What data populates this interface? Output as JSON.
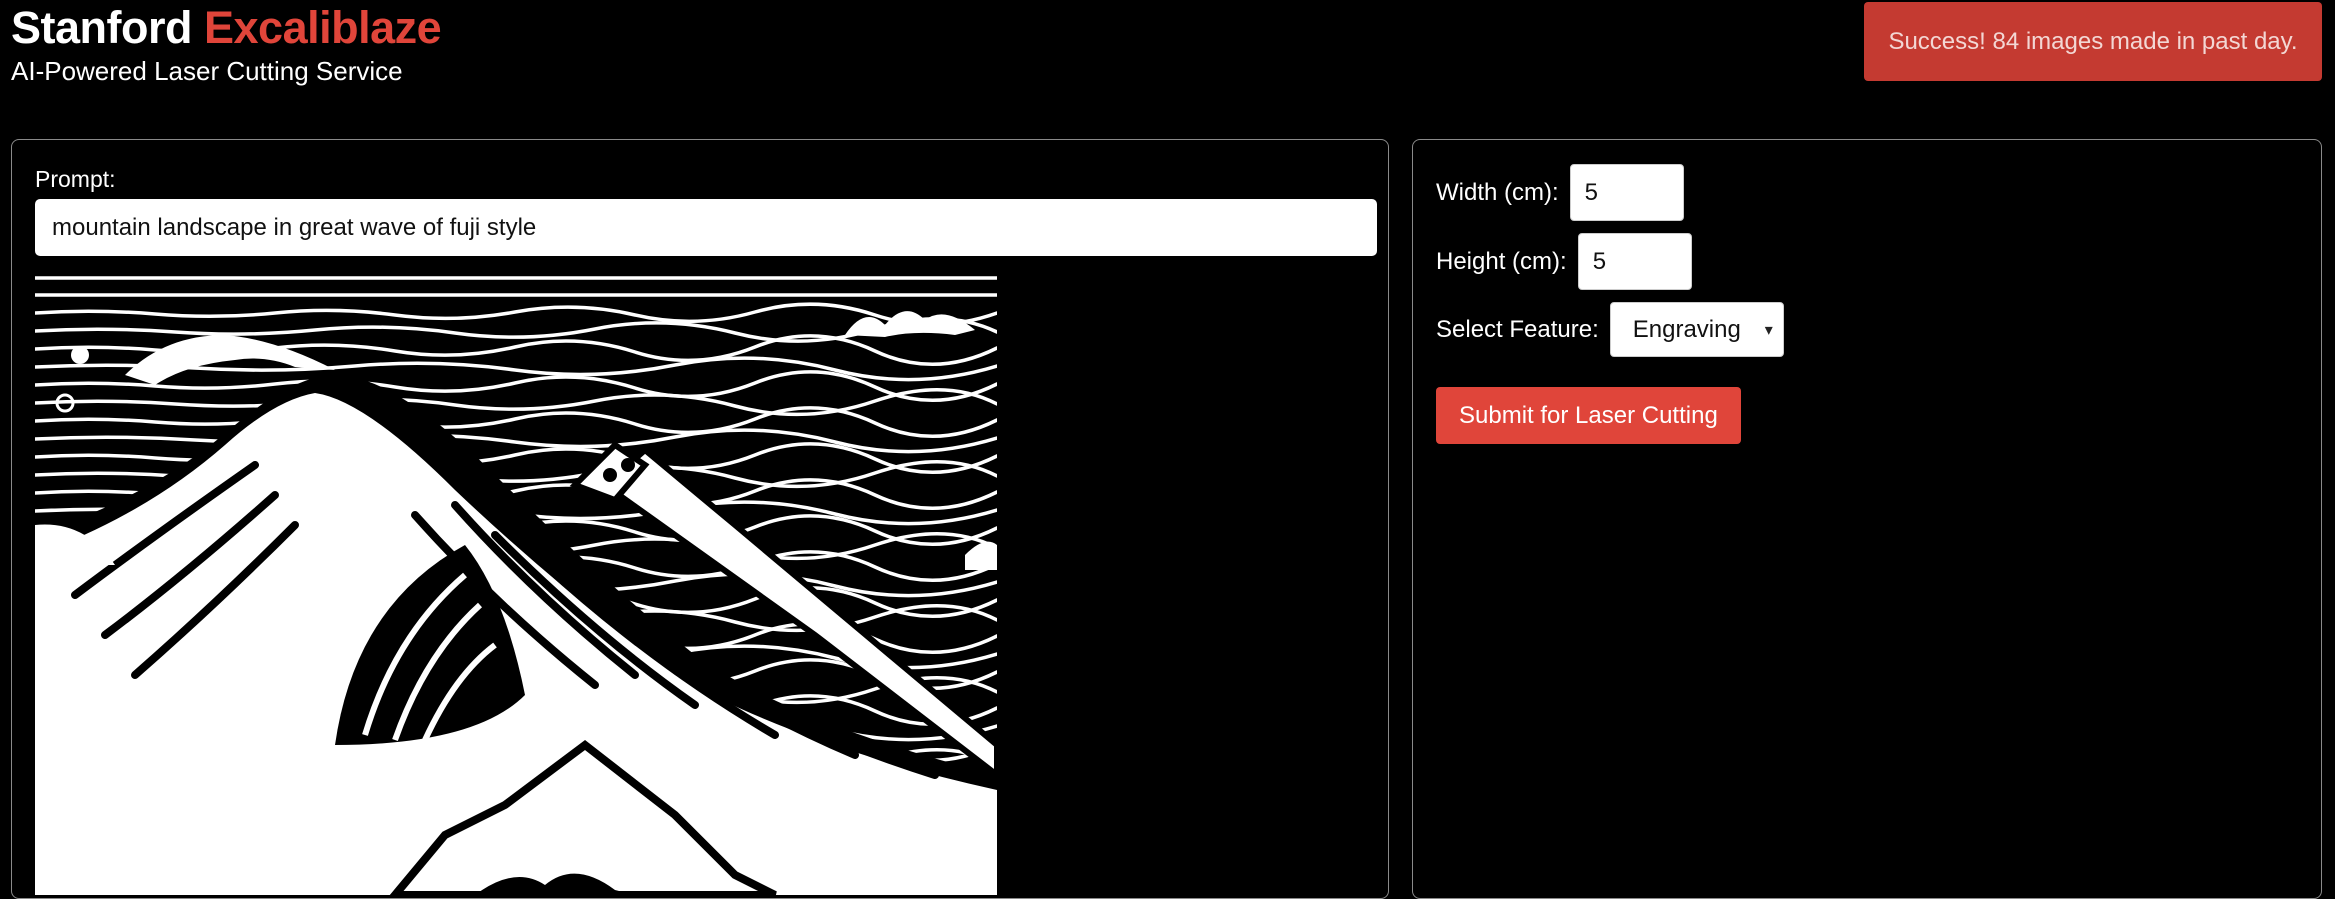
{
  "header": {
    "brand_primary": "Stanford",
    "brand_accent": "Excaliblaze",
    "tagline": "AI-Powered Laser Cutting Service"
  },
  "toast": {
    "message": "Success! 84 images made in past day."
  },
  "prompt": {
    "label": "Prompt:",
    "value": "mountain landscape in great wave of fuji style"
  },
  "settings": {
    "width_label": "Width (cm):",
    "width_value": "5",
    "height_label": "Height (cm):",
    "height_value": "5",
    "feature_label": "Select Feature:",
    "feature_value": "Engraving",
    "submit_label": "Submit for Laser Cutting"
  },
  "colors": {
    "accent": "#e0453a",
    "toast_bg": "#c43a31",
    "background": "#000000"
  },
  "icons": {
    "select_chevron": "chevron-down-icon"
  }
}
